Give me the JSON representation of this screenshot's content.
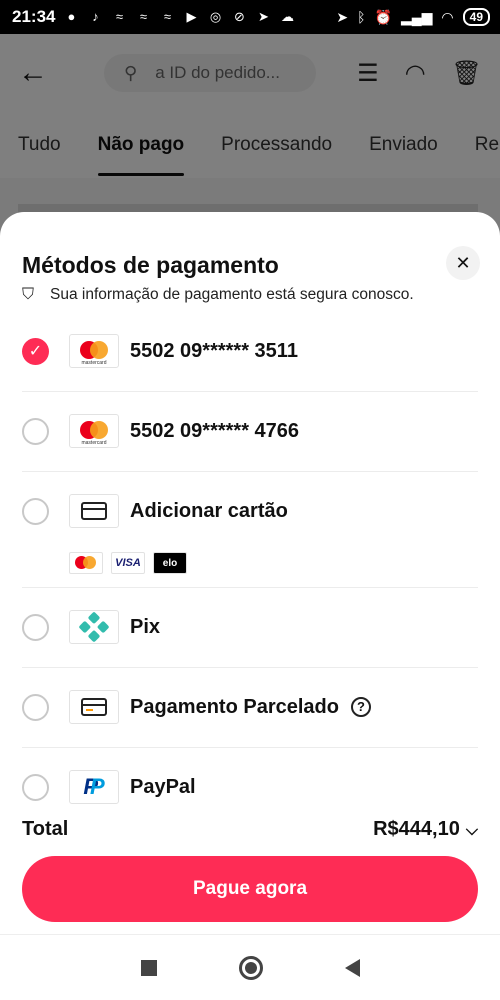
{
  "status_bar": {
    "time": "21:34",
    "battery": "49"
  },
  "header": {
    "search_placeholder": "a ID do pedido..."
  },
  "tabs": [
    "Tudo",
    "Não pago",
    "Processando",
    "Enviado",
    "Re"
  ],
  "sheet": {
    "title": "Métodos de pagamento",
    "secure_text": "Sua informação de pagamento está segura conosco.",
    "methods": [
      {
        "label": "5502 09****** 3511",
        "selected": true,
        "icon": "mastercard-icon"
      },
      {
        "label": "5502 09****** 4766",
        "selected": false,
        "icon": "mastercard-icon"
      },
      {
        "label": "Adicionar cartão",
        "selected": false,
        "icon": "card-icon",
        "brands": [
          "mastercard",
          "VISA",
          "elo"
        ]
      },
      {
        "label": "Pix",
        "selected": false,
        "icon": "pix-icon"
      },
      {
        "label": "Pagamento Parcelado",
        "selected": false,
        "icon": "card-icon"
      },
      {
        "label": "PayPal",
        "selected": false,
        "icon": "paypal-icon"
      }
    ],
    "mc_word": "mastercard",
    "total_label": "Total",
    "total_value": "R$444,10",
    "pay_button": "Pague agora"
  },
  "colors": {
    "accent": "#fe2c55"
  }
}
